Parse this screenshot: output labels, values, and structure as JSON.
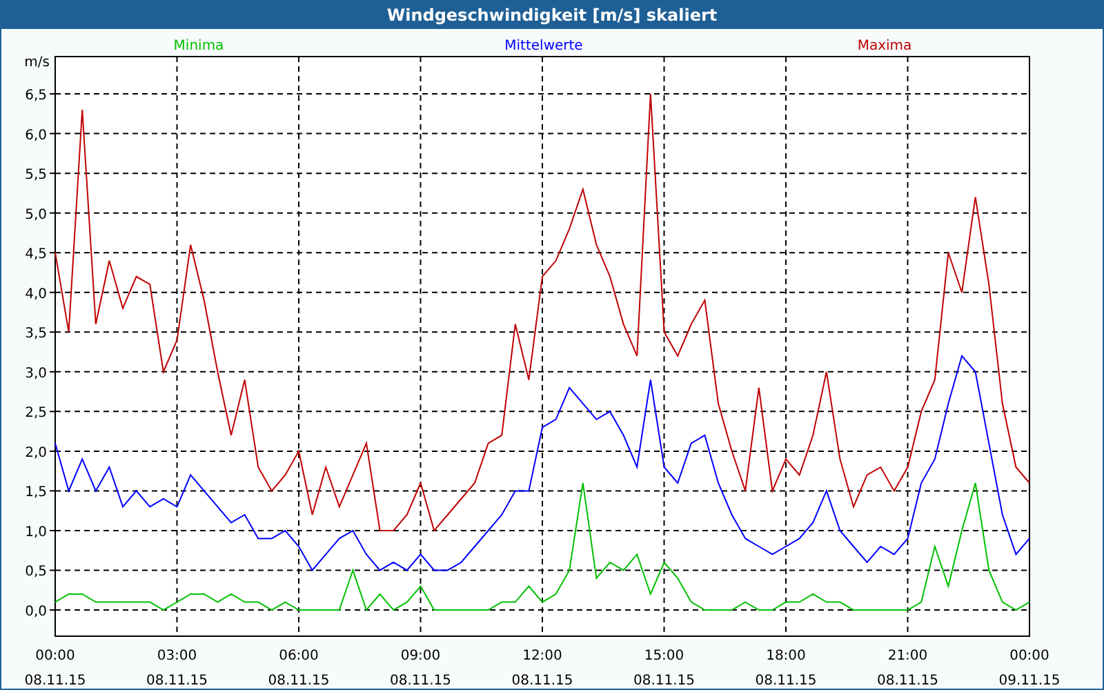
{
  "window": {
    "title": "Windgeschwindigkeit [m/s] skaliert"
  },
  "chart": {
    "chart_data": {
      "type": "line",
      "grid": true,
      "ylabel": "m/s",
      "ylim": [
        -0.33,
        6.97
      ],
      "categories": [
        "00:00 08.11.15",
        null,
        null,
        null,
        null,
        null,
        null,
        null,
        null,
        "03:00 08.11.15",
        null,
        null,
        null,
        null,
        null,
        null,
        null,
        null,
        "06:00 08.11.15",
        null,
        null,
        null,
        null,
        null,
        null,
        null,
        null,
        "09:00 08.11.15",
        null,
        null,
        null,
        null,
        null,
        null,
        null,
        null,
        "12:00 08.11.15",
        null,
        null,
        null,
        null,
        null,
        null,
        null,
        null,
        "15:00 08.11.15",
        null,
        null,
        null,
        null,
        null,
        null,
        null,
        null,
        "18:00 08.11.15",
        null,
        null,
        null,
        null,
        null,
        null,
        null,
        null,
        "21:00 08.11.15",
        null,
        null,
        null,
        null,
        null,
        null,
        null,
        null,
        "00:00 09.11.15"
      ],
      "series": [
        {
          "name": "Minima",
          "color": "#00c000",
          "values": [
            0.1,
            0.2,
            0.2,
            0.1,
            0.1,
            0.1,
            0.1,
            0.1,
            0.0,
            0.1,
            0.2,
            0.2,
            0.1,
            0.2,
            0.1,
            0.1,
            0.0,
            0.1,
            0.0,
            0.0,
            0.0,
            0.0,
            0.5,
            0.0,
            0.2,
            0.0,
            0.1,
            0.3,
            0.0,
            0.0,
            0.0,
            0.0,
            0.0,
            0.1,
            0.1,
            0.3,
            0.1,
            0.2,
            0.5,
            1.6,
            0.4,
            0.6,
            0.5,
            0.7,
            0.2,
            0.6,
            0.4,
            0.1,
            0.0,
            0.0,
            0.0,
            0.1,
            0.0,
            0.0,
            0.1,
            0.1,
            0.2,
            0.1,
            0.1,
            0.0,
            0.0,
            0.0,
            0.0,
            0.0,
            0.1,
            0.8,
            0.3,
            1.0,
            1.6,
            0.5,
            0.1,
            0.0,
            0.1
          ]
        },
        {
          "name": "Mittelwerte",
          "color": "#0000ff",
          "values": [
            2.1,
            1.5,
            1.9,
            1.5,
            1.8,
            1.3,
            1.5,
            1.3,
            1.4,
            1.3,
            1.7,
            1.5,
            1.3,
            1.1,
            1.2,
            0.9,
            0.9,
            1.0,
            0.8,
            0.5,
            0.7,
            0.9,
            1.0,
            0.7,
            0.5,
            0.6,
            0.5,
            0.7,
            0.5,
            0.5,
            0.6,
            0.8,
            1.0,
            1.2,
            1.5,
            1.5,
            2.3,
            2.4,
            2.8,
            2.6,
            2.4,
            2.5,
            2.2,
            1.8,
            2.9,
            1.8,
            1.6,
            2.1,
            2.2,
            1.6,
            1.2,
            0.9,
            0.8,
            0.7,
            0.8,
            0.9,
            1.1,
            1.5,
            1.0,
            0.8,
            0.6,
            0.8,
            0.7,
            0.9,
            1.6,
            1.9,
            2.6,
            3.2,
            3.0,
            2.1,
            1.2,
            0.7,
            0.9
          ]
        },
        {
          "name": "Maxima",
          "color": "#c00000",
          "values": [
            4.5,
            3.5,
            6.3,
            3.6,
            4.4,
            3.8,
            4.2,
            4.1,
            3.0,
            3.4,
            4.6,
            3.9,
            3.0,
            2.2,
            2.9,
            1.8,
            1.5,
            1.7,
            2.0,
            1.2,
            1.8,
            1.3,
            1.7,
            2.1,
            1.0,
            1.0,
            1.2,
            1.6,
            1.0,
            1.2,
            1.4,
            1.6,
            2.1,
            2.2,
            3.6,
            2.9,
            4.2,
            4.4,
            4.8,
            5.3,
            4.6,
            4.2,
            3.6,
            3.2,
            6.5,
            3.5,
            3.2,
            3.6,
            3.9,
            2.6,
            2.0,
            1.5,
            2.8,
            1.5,
            1.9,
            1.7,
            2.2,
            3.0,
            1.9,
            1.3,
            1.7,
            1.8,
            1.5,
            1.8,
            2.5,
            2.9,
            4.5,
            4.0,
            5.2,
            4.1,
            2.6,
            1.8,
            1.6
          ]
        }
      ],
      "yticks": [
        {
          "value": 0,
          "label": "0,0"
        },
        {
          "value": 0.5,
          "label": "0,5"
        },
        {
          "value": 1,
          "label": "1,0"
        },
        {
          "value": 1.5,
          "label": "1,5"
        },
        {
          "value": 2,
          "label": "2,0"
        },
        {
          "value": 2.5,
          "label": "2,5"
        },
        {
          "value": 3,
          "label": "3,0"
        },
        {
          "value": 3.5,
          "label": "3,5"
        },
        {
          "value": 4,
          "label": "4,0"
        },
        {
          "value": 4.5,
          "label": "4,5"
        },
        {
          "value": 5,
          "label": "5,0"
        },
        {
          "value": 5.5,
          "label": "5,5"
        },
        {
          "value": 6,
          "label": "6,0"
        },
        {
          "value": 6.5,
          "label": "6,5"
        }
      ]
    }
  }
}
